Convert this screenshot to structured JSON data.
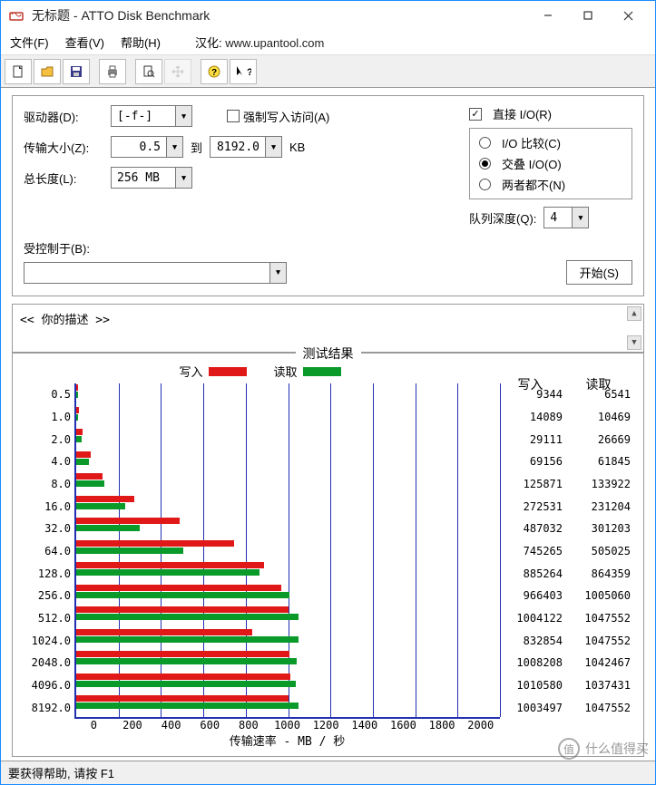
{
  "window": {
    "title": "无标题 - ATTO Disk Benchmark"
  },
  "menu": {
    "file": "文件(F)",
    "view": "查看(V)",
    "help": "帮助(H)",
    "han": "汉化:",
    "link": "www.upantool.com"
  },
  "settings": {
    "drive_label": "驱动器(D):",
    "drive_value": "[-f-]",
    "xfer_label": "传输大小(Z):",
    "xfer_from": "0.5",
    "to_label": "到",
    "xfer_to": "8192.0",
    "kb": "KB",
    "len_label": "总长度(L):",
    "len_value": "256 MB",
    "force_write": "强制写入访问(A)",
    "direct_io": "直接 I/O(R)",
    "io_compare": "I/O 比较(C)",
    "overlap": "交叠 I/O(O)",
    "neither": "两者都不(N)",
    "queue_label": "队列深度(Q):",
    "queue_value": "4",
    "controlled_label": "受控制于(B):",
    "start": "开始(S)"
  },
  "desc": "<<  你的描述  >>",
  "results": {
    "title": "测试结果",
    "write_label": "写入",
    "read_label": "读取",
    "xaxis": "传输速率 - MB / 秒",
    "xticks": [
      "0",
      "200",
      "400",
      "600",
      "800",
      "1000",
      "1200",
      "1400",
      "1600",
      "1800",
      "2000"
    ]
  },
  "chart_data": {
    "type": "bar",
    "xlabel": "传输速率 - MB / 秒",
    "ylabel": "",
    "xlim": [
      0,
      2000
    ],
    "categories": [
      "0.5",
      "1.0",
      "2.0",
      "4.0",
      "8.0",
      "16.0",
      "32.0",
      "64.0",
      "128.0",
      "256.0",
      "512.0",
      "1024.0",
      "2048.0",
      "4096.0",
      "8192.0"
    ],
    "series": [
      {
        "name": "写入",
        "color": "#e01818",
        "values": [
          9344,
          14089,
          29111,
          69156,
          125871,
          272531,
          487032,
          745265,
          885264,
          966403,
          1004122,
          832854,
          1008208,
          1010580,
          1003497
        ]
      },
      {
        "name": "读取",
        "color": "#0a9a2a",
        "values": [
          6541,
          10469,
          26669,
          61845,
          133922,
          231204,
          301203,
          505025,
          864359,
          1005060,
          1047552,
          1047552,
          1042467,
          1037431,
          1047552
        ]
      }
    ],
    "note": "display values are KB/s; bar lengths scale as KB/s÷1000 against 0–2000 MB/s axis"
  },
  "status": "要获得帮助, 请按 F1",
  "watermark": "什么值得买"
}
